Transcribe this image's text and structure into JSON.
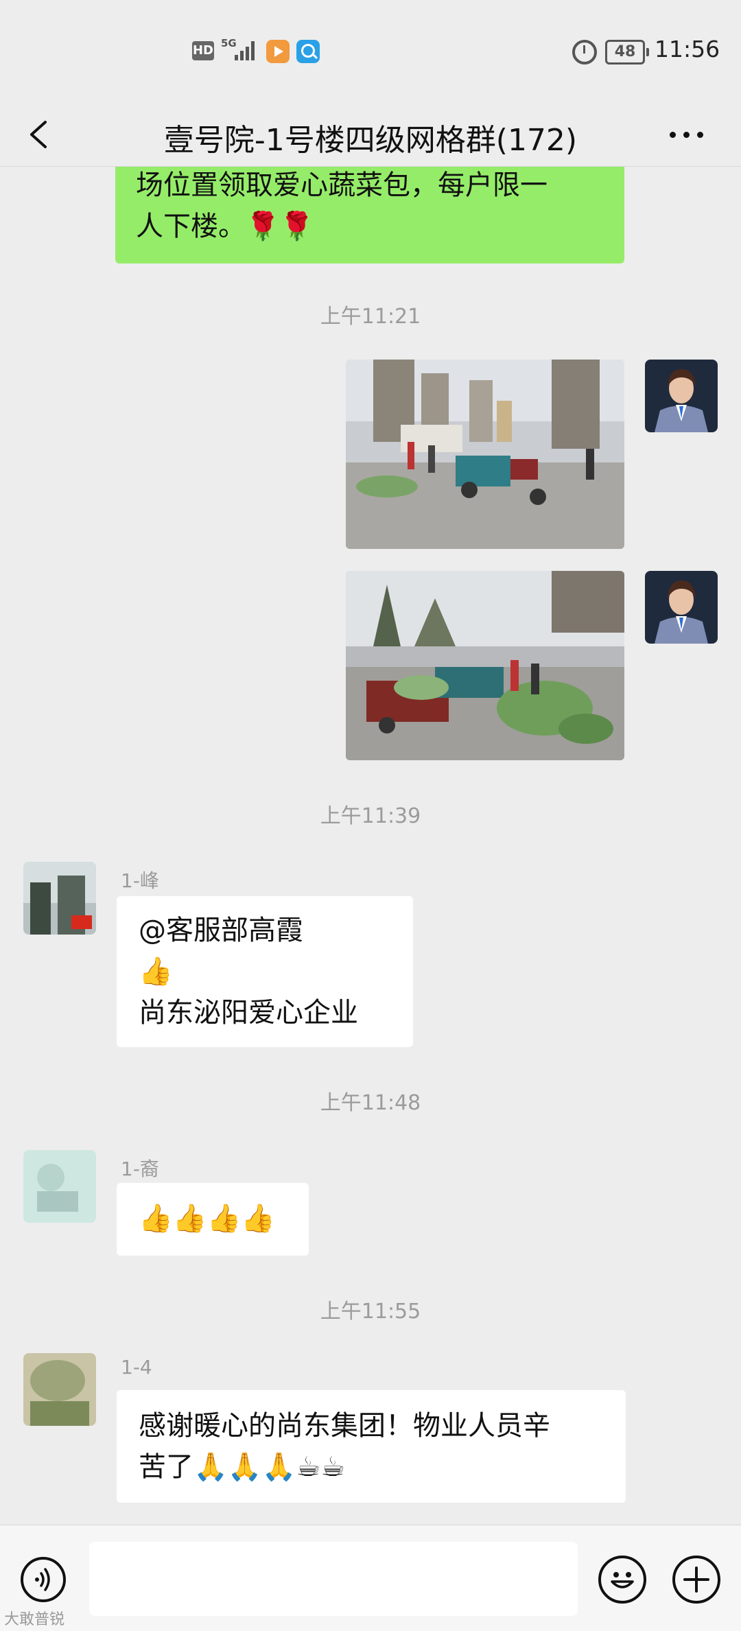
{
  "status_bar": {
    "hd": "HD",
    "network": "5G",
    "battery": "48",
    "time": "11:56"
  },
  "header": {
    "title": "壹号院-1号楼四级网格群(172)"
  },
  "messages": {
    "m0": {
      "lines": [
        "场位置领取爱心蔬菜包，每户限一",
        "人下楼。🌹🌹"
      ]
    },
    "ts1": "上午11:21",
    "ts2": "上午11:39",
    "m3": {
      "sender": "1-峰",
      "lines": [
        "@客服部高霞",
        "👍",
        "尚东泌阳爱心企业"
      ]
    },
    "ts3": "上午11:48",
    "m4": {
      "sender": "1-裔",
      "lines": [
        "👍👍👍👍"
      ]
    },
    "ts4": "上午11:55",
    "m5": {
      "sender": "1-4",
      "lines": [
        "感谢暖心的尚东集团！物业人员辛",
        "苦了🙏🙏🙏☕☕"
      ]
    }
  },
  "watermark": "大敢普锐",
  "colors": {
    "bubble_self": "#95ec69",
    "bubble_other": "#ffffff",
    "background": "#ededed",
    "timestamp": "#9b9b9b"
  },
  "icons": {
    "back": "chevron-left-icon",
    "more": "more-dots-icon",
    "voice": "voice-icon",
    "emoji": "emoji-icon",
    "plus": "plus-icon"
  }
}
